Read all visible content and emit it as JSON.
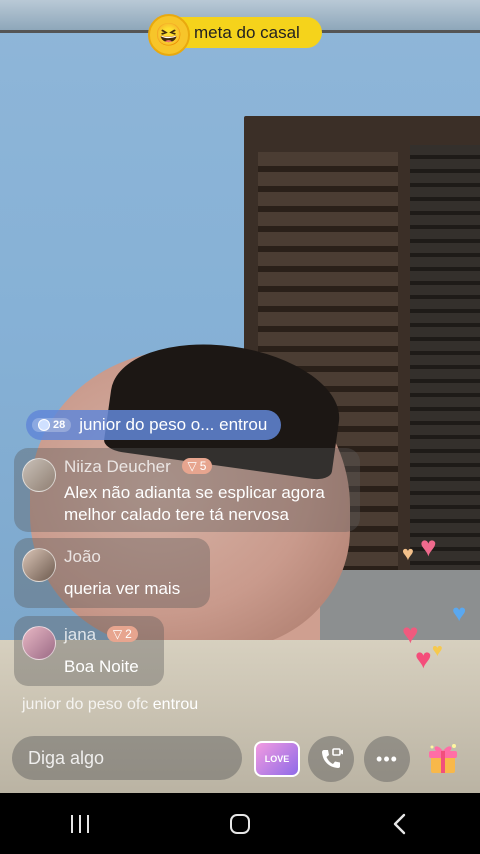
{
  "stream": {
    "goal_label": "meta do casal",
    "goal_emoji": "😆"
  },
  "join_banner": {
    "level": "28",
    "text": "junior do peso o... entrou"
  },
  "messages": [
    {
      "name": "Niiza Deucher",
      "badge_level": "5",
      "line1": "Alex não adianta se esplicar agora",
      "line2": "melhor calado tere tá nervosa"
    },
    {
      "name": "João",
      "line1": "queria ver mais"
    },
    {
      "name": "jana",
      "badge_level": "2",
      "line1": "Boa Noite"
    }
  ],
  "entry_notice": {
    "user": "junior do peso ofc",
    "action": "entrou"
  },
  "input": {
    "placeholder": "Diga algo"
  },
  "buttons": {
    "love_label": "LOVE",
    "more_label": "•••"
  },
  "icons": {
    "badge": "cup-icon",
    "call": "video-call-icon",
    "gift": "gift-icon"
  },
  "colors": {
    "goal_pill": "#f5d31b",
    "join_banner": "#6287d7",
    "badge": "#e7a58f"
  }
}
